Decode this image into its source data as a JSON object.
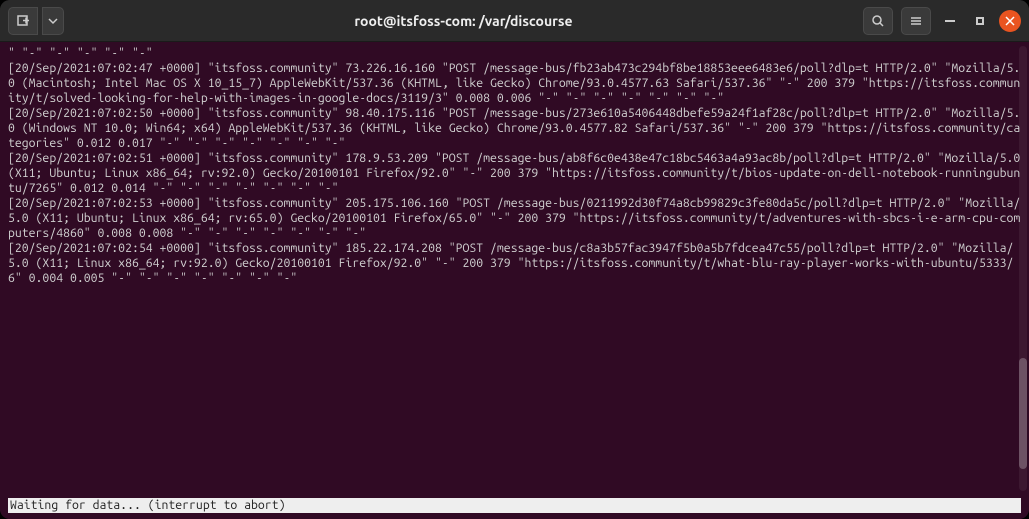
{
  "window": {
    "title": "root@itsfoss-com: /var/discourse"
  },
  "terminal": {
    "status_line": "Waiting for data... (interrupt to abort)",
    "log_entries": [
      "\" \"-\" \"-\" \"-\" \"-\" \"-\"",
      "[20/Sep/2021:07:02:47 +0000] \"itsfoss.community\" 73.226.16.160 \"POST /message-bus/fb23ab473c294bf8be18853eee6483e6/poll?dlp=t HTTP/2.0\" \"Mozilla/5.0 (Macintosh; Intel Mac OS X 10_15_7) AppleWebKit/537.36 (KHTML, like Gecko) Chrome/93.0.4577.63 Safari/537.36\" \"-\" 200 379 \"https://itsfoss.community/t/solved-looking-for-help-with-images-in-google-docs/3119/3\" 0.008 0.006 \"-\" \"-\" \"-\" \"-\" \"-\" \"-\" \"-\"",
      "[20/Sep/2021:07:02:50 +0000] \"itsfoss.community\" 98.40.175.116 \"POST /message-bus/273e610a5406448dbefe59a24f1af28c/poll?dlp=t HTTP/2.0\" \"Mozilla/5.0 (Windows NT 10.0; Win64; x64) AppleWebKit/537.36 (KHTML, like Gecko) Chrome/93.0.4577.82 Safari/537.36\" \"-\" 200 379 \"https://itsfoss.community/categories\" 0.012 0.017 \"-\" \"-\" \"-\" \"-\" \"-\" \"-\" \"-\"",
      "[20/Sep/2021:07:02:51 +0000] \"itsfoss.community\" 178.9.53.209 \"POST /message-bus/ab8f6c0e438e47c18bc5463a4a93ac8b/poll?dlp=t HTTP/2.0\" \"Mozilla/5.0 (X11; Ubuntu; Linux x86_64; rv:92.0) Gecko/20100101 Firefox/92.0\" \"-\" 200 379 \"https://itsfoss.community/t/bios-update-on-dell-notebook-runningubuntu/7265\" 0.012 0.014 \"-\" \"-\" \"-\" \"-\" \"-\" \"-\" \"-\"",
      "[20/Sep/2021:07:02:53 +0000] \"itsfoss.community\" 205.175.106.160 \"POST /message-bus/0211992d30f74a8cb99829c3fe80da5c/poll?dlp=t HTTP/2.0\" \"Mozilla/5.0 (X11; Ubuntu; Linux x86_64; rv:65.0) Gecko/20100101 Firefox/65.0\" \"-\" 200 379 \"https://itsfoss.community/t/adventures-with-sbcs-i-e-arm-cpu-computers/4860\" 0.008 0.008 \"-\" \"-\" \"-\" \"-\" \"-\" \"-\" \"-\"",
      "[20/Sep/2021:07:02:54 +0000] \"itsfoss.community\" 185.22.174.208 \"POST /message-bus/c8a3b57fac3947f5b0a5b7fdcea47c55/poll?dlp=t HTTP/2.0\" \"Mozilla/5.0 (X11; Linux x86_64; rv:92.0) Gecko/20100101 Firefox/92.0\" \"-\" 200 379 \"https://itsfoss.community/t/what-blu-ray-player-works-with-ubuntu/5333/6\" 0.004 0.005 \"-\" \"-\" \"-\" \"-\" \"-\" \"-\" \"-\""
    ]
  }
}
